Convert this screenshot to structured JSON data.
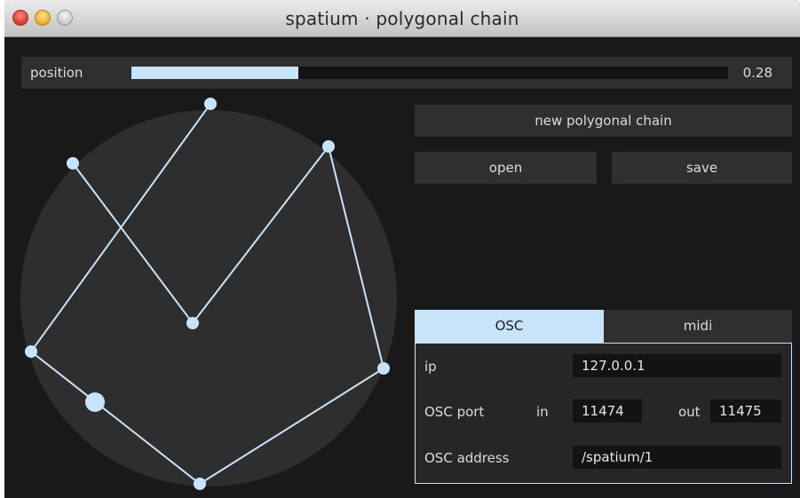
{
  "window": {
    "title": "spatium · polygonal chain"
  },
  "position": {
    "label": "position",
    "value_text": "0.28",
    "value": 0.28
  },
  "buttons": {
    "new_chain": "new polygonal chain",
    "open": "open",
    "save": "save"
  },
  "tabs": [
    {
      "label": "OSC",
      "active": true
    },
    {
      "label": "midi",
      "active": false
    }
  ],
  "osc": {
    "ip_label": "ip",
    "ip_value": "127.0.0.1",
    "port_label": "OSC port",
    "in_label": "in",
    "in_value": "11474",
    "out_label": "out",
    "out_value": "11475",
    "address_label": "OSC address",
    "address_value": "/spatium/1"
  },
  "colors": {
    "accent": "#c8e4fb",
    "panel": "#2f2f2f",
    "background": "#191919",
    "circle": "#2e2e2e"
  }
}
